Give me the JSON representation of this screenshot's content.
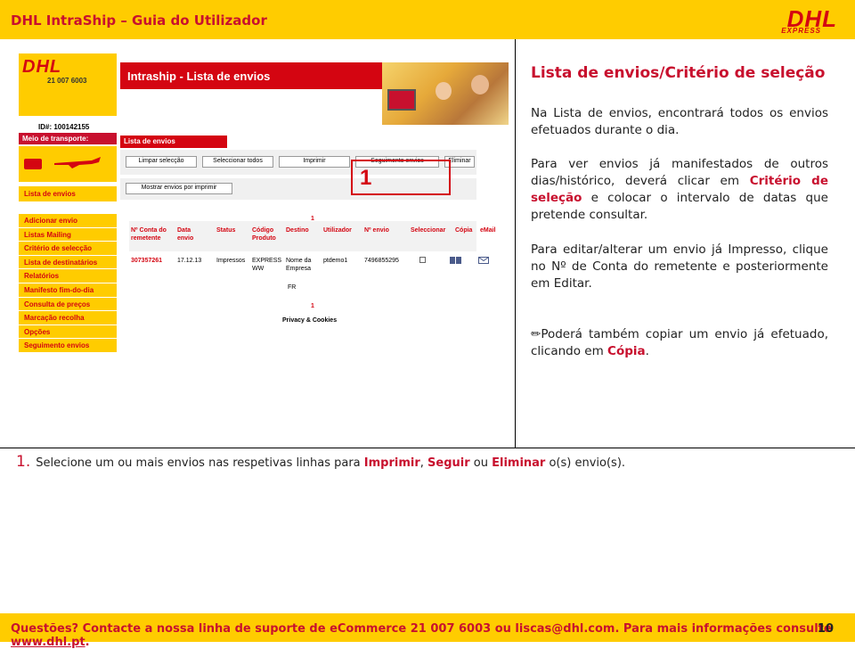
{
  "header": {
    "title": "DHL IntraShip – Guia do Utilizador",
    "logo_text": "DHL",
    "logo_sub": "EXPRESS"
  },
  "screenshot": {
    "logo_text": "DHL",
    "phone": "21 007 6003",
    "id_label": "ID#: 100142155",
    "meio_label": "Meio de transporte:",
    "lista_envios_nav": "Lista de envios",
    "menu": [
      "Adicionar envio",
      "Listas Mailing",
      "Critério de selecção",
      "Lista de destinatários",
      "Relatórios",
      "Manifesto fim-do-dia",
      "Consulta de preços",
      "Marcação recolha",
      "Opções",
      "Seguimento envios"
    ],
    "page_title": "Intraship - Lista de envios",
    "section_label": "Lista de envios",
    "buttons": {
      "limpar": "Limpar selecção",
      "seleccionar_todos": "Seleccionar todos",
      "imprimir": "Imprimir",
      "seguimento": "Seguimento envios",
      "eliminar": "Eliminar",
      "mostrar": "Mostrar envios por imprimir"
    },
    "page_num_top": "1",
    "page_num_bottom": "1",
    "columns": [
      "Nº Conta do remetente",
      "Data envio",
      "Status",
      "Código Produto",
      "Destino",
      "Utilizador",
      "Nº envio",
      "Seleccionar",
      "Cópia",
      "eMail"
    ],
    "row": {
      "conta": "307357261",
      "data": "17.12.13",
      "status": "Impressos",
      "produto": "EXPRESS WW",
      "destino": "Nome da Empresa",
      "destino_pais": "FR",
      "utilizador": "ptdemo1",
      "envio": "7496855295"
    },
    "callout_number": "1",
    "privacy": "Privacy & Cookies"
  },
  "content": {
    "title": "Lista de envios/Critério de seleção",
    "p1": "Na Lista de envios, encontrará todos os envios efetuados durante o dia.",
    "p2_a": "Para ver envios já manifestados de outros dias/histórico, deverá clicar em ",
    "p2_link": "Critério de seleção",
    "p2_b": " e colocar o intervalo de datas que pretende consultar.",
    "p3": "Para editar/alterar um envio já Impresso, clique no Nº de Conta do remetente e posteriormente em Editar.",
    "p4_a": "Poderá também copiar um envio já efetuado, clicando em ",
    "p4_link": "Cópia",
    "p4_b": ".",
    "pencil_icon": "✏"
  },
  "note": {
    "number": "1.",
    "text_a": "Selecione um ou mais envios nas respetivas linhas para ",
    "imprimir": "Imprimir",
    "sep1": ", ",
    "seguir": "Seguir",
    "sep2": " ou ",
    "eliminar": "Eliminar",
    "text_b": " o(s) envio(s)."
  },
  "footer": {
    "text": "Questões? Contacte a nossa linha de suporte de eCommerce 21 007 6003 ou liscas@dhl.com. Para mais informações consulte ",
    "link": "www.dhl.pt",
    "after": ".",
    "page": "10"
  },
  "colors": {
    "dhl_yellow": "#ffcc00",
    "dhl_red": "#d40511"
  }
}
